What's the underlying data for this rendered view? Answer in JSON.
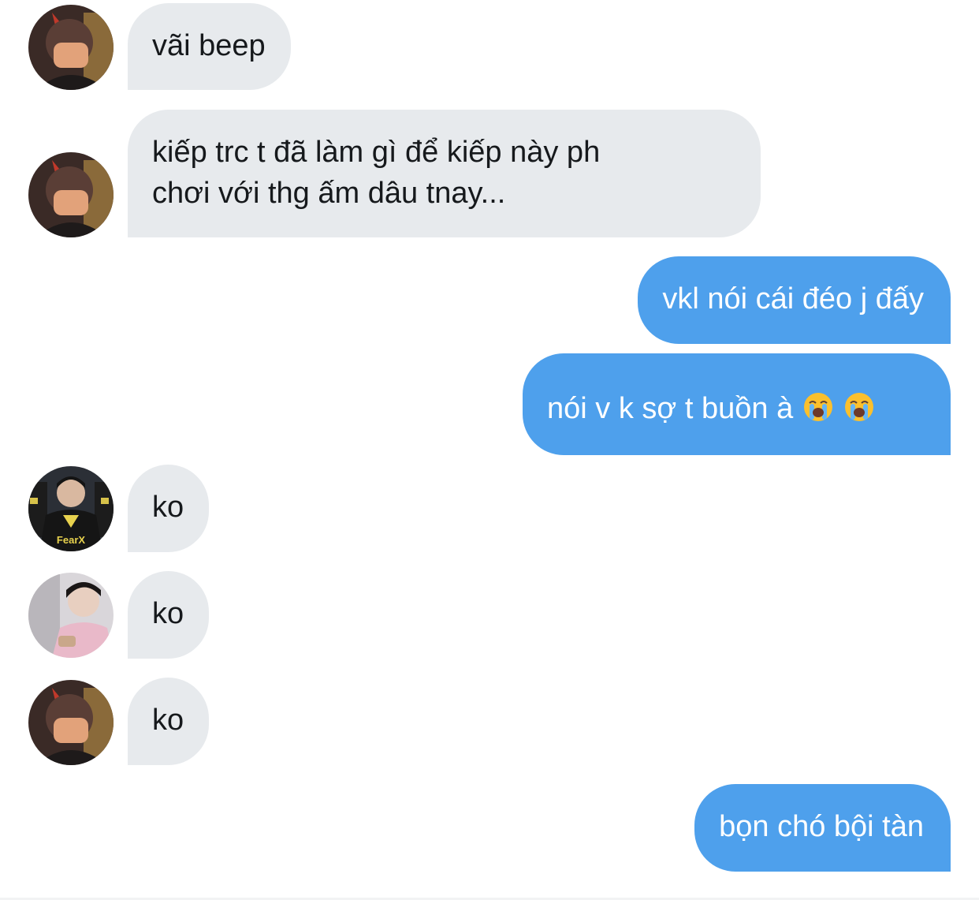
{
  "messages": [
    {
      "side": "in",
      "sender": "masked-friend",
      "text": "vãi beep"
    },
    {
      "side": "in",
      "sender": "masked-friend",
      "lines": [
        "kiếp trc t đã làm gì để kiếp này ph",
        "chơi với thg ấm dâu tnay..."
      ]
    },
    {
      "side": "out",
      "text": "vkl nói cái đéo j đấy"
    },
    {
      "side": "out",
      "text": "nói v k sợ t buồn à",
      "emojis": [
        "loudly-crying-face-icon",
        "loudly-crying-face-icon"
      ]
    },
    {
      "side": "in",
      "sender": "fearx-jersey-friend",
      "text": "ko"
    },
    {
      "side": "in",
      "sender": "pink-hoodie-friend",
      "text": "ko"
    },
    {
      "side": "in",
      "sender": "masked-friend",
      "text": "ko"
    },
    {
      "side": "out",
      "text": "bọn chó bội tàn"
    }
  ],
  "avatar_badges": {
    "fearx_jersey_text": "FearX"
  },
  "colors": {
    "incoming_bubble": "#e7eaed",
    "outgoing_bubble": "#4ea0ec",
    "incoming_text": "#16191c",
    "outgoing_text": "#ffffff"
  }
}
